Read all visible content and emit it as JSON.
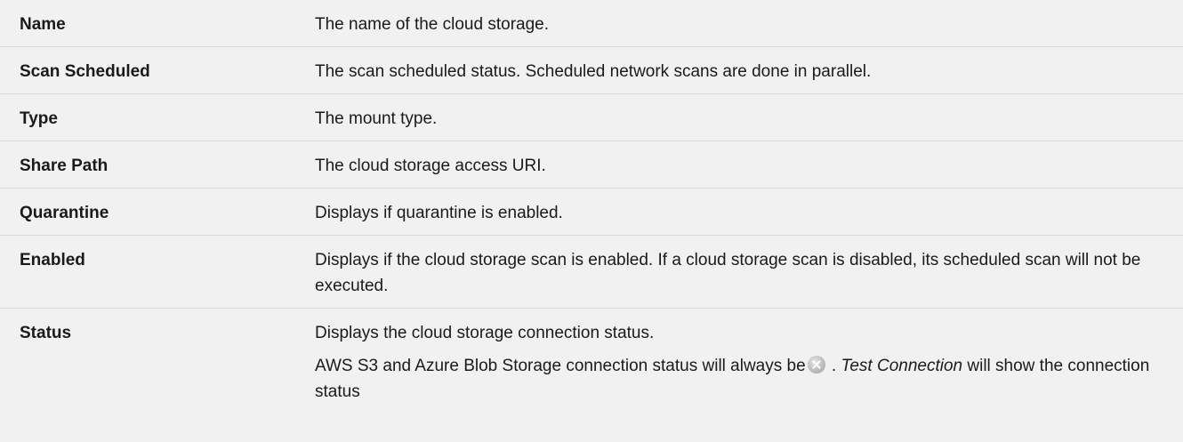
{
  "rows": [
    {
      "name": "Name",
      "description": "The name of the cloud storage."
    },
    {
      "name": "Scan Scheduled",
      "description": "The scan scheduled status. Scheduled network scans are done in parallel."
    },
    {
      "name": "Type",
      "description": "The mount type."
    },
    {
      "name": "Share Path",
      "description": "The cloud storage access URI."
    },
    {
      "name": "Quarantine",
      "description": "Displays if quarantine is enabled."
    },
    {
      "name": "Enabled",
      "description": "Displays if the cloud storage scan is enabled. If a cloud storage scan is disabled, its scheduled scan will not be executed."
    },
    {
      "name": "Status",
      "description": "Displays the cloud storage connection status.",
      "note_prefix": "AWS S3 and Azure Blob Storage connection status will always be",
      "note_icon": "disconnected-status-icon",
      "note_sep": " . ",
      "note_italic": "Test Connection",
      "note_suffix": " will show the connection status"
    }
  ]
}
